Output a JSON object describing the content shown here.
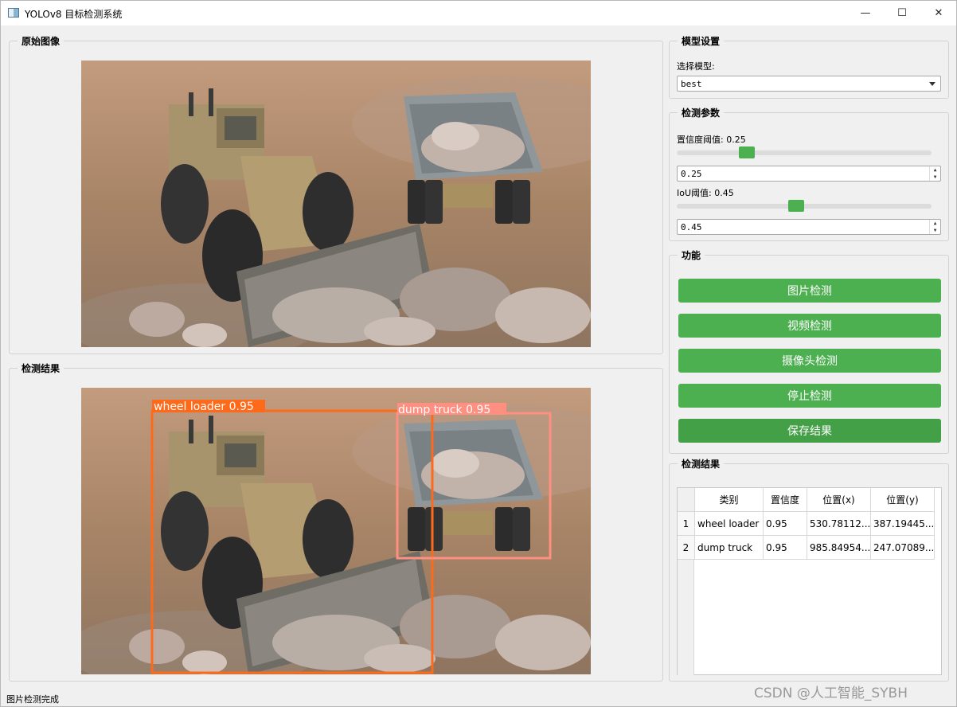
{
  "window": {
    "title": "YOLOv8 目标检测系统",
    "minimize": "—",
    "maximize": "☐",
    "close": "✕"
  },
  "original": {
    "title": "原始图像"
  },
  "result": {
    "title": "检测结果",
    "boxes": [
      {
        "label": "wheel loader 0.95",
        "color": "#ff6a1a"
      },
      {
        "label": "dump truck 0.95",
        "color": "#ff8f80"
      }
    ]
  },
  "model": {
    "title": "模型设置",
    "select_label": "选择模型:",
    "selected": "best"
  },
  "params": {
    "title": "检测参数",
    "conf_label": "置信度阈值: 0.25",
    "conf_value": "0.25",
    "conf_fraction": 0.25,
    "iou_label": "IoU阈值: 0.45",
    "iou_value": "0.45",
    "iou_fraction": 0.45
  },
  "functions": {
    "title": "功能",
    "buttons": [
      "图片检测",
      "视频检测",
      "摄像头检测",
      "停止检测",
      "保存结果"
    ]
  },
  "results_table": {
    "title": "检测结果",
    "headers": [
      "类别",
      "置信度",
      "位置(x)",
      "位置(y)"
    ],
    "rows": [
      {
        "num": "1",
        "cls": "wheel loader",
        "conf": "0.95",
        "x": "530.78112...",
        "y": "387.19445..."
      },
      {
        "num": "2",
        "cls": "dump truck",
        "conf": "0.95",
        "x": "985.84954...",
        "y": "247.07089..."
      }
    ]
  },
  "status": "图片检测完成",
  "watermark": "CSDN @人工智能_SYBH",
  "colors": {
    "accent": "#4caf50",
    "box_loader": "#ff6a1a",
    "box_truck": "#ff8f80"
  }
}
